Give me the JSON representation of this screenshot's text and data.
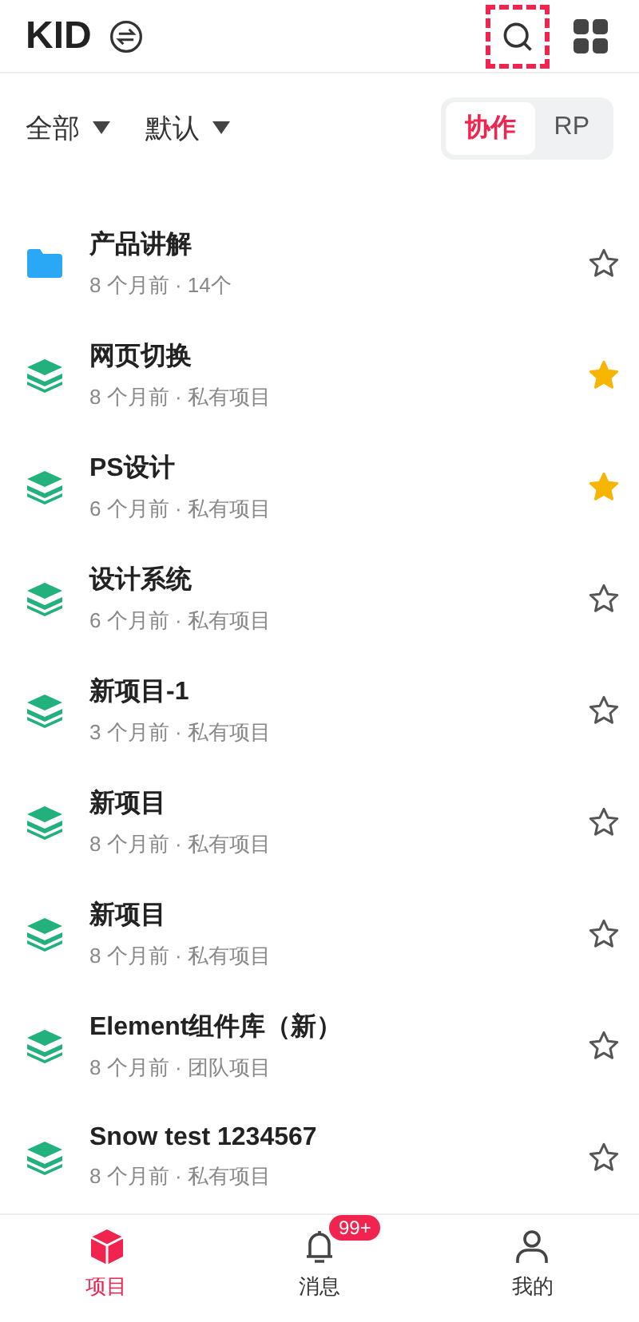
{
  "header": {
    "title": "KID"
  },
  "filters": [
    {
      "label": "全部"
    },
    {
      "label": "默认"
    }
  ],
  "segments": [
    {
      "label": "协作",
      "selected": true
    },
    {
      "label": "RP",
      "selected": false
    }
  ],
  "items": [
    {
      "kind": "folder",
      "name": "产品讲解",
      "meta": "8 个月前 · 14个",
      "starred": false
    },
    {
      "kind": "project",
      "name": "网页切换",
      "meta": "8 个月前 · 私有项目",
      "starred": true
    },
    {
      "kind": "project",
      "name": "PS设计",
      "meta": "6 个月前 · 私有项目",
      "starred": true
    },
    {
      "kind": "project",
      "name": "设计系统",
      "meta": "6 个月前 · 私有项目",
      "starred": false
    },
    {
      "kind": "project",
      "name": "新项目-1",
      "meta": "3 个月前 · 私有项目",
      "starred": false
    },
    {
      "kind": "project",
      "name": "新项目",
      "meta": "8 个月前 · 私有项目",
      "starred": false
    },
    {
      "kind": "project",
      "name": "新项目",
      "meta": "8 个月前 · 私有项目",
      "starred": false
    },
    {
      "kind": "project",
      "name": "Element组件库（新）",
      "meta": "8 个月前 · 团队项目",
      "starred": false
    },
    {
      "kind": "project",
      "name": "Snow test 1234567",
      "meta": "8 个月前 · 私有项目",
      "starred": false
    }
  ],
  "tabbar": [
    {
      "kind": "projects",
      "label": "项目",
      "selected": true
    },
    {
      "kind": "messages",
      "label": "消息",
      "selected": false,
      "badge": "99+"
    },
    {
      "kind": "me",
      "label": "我的",
      "selected": false
    }
  ]
}
